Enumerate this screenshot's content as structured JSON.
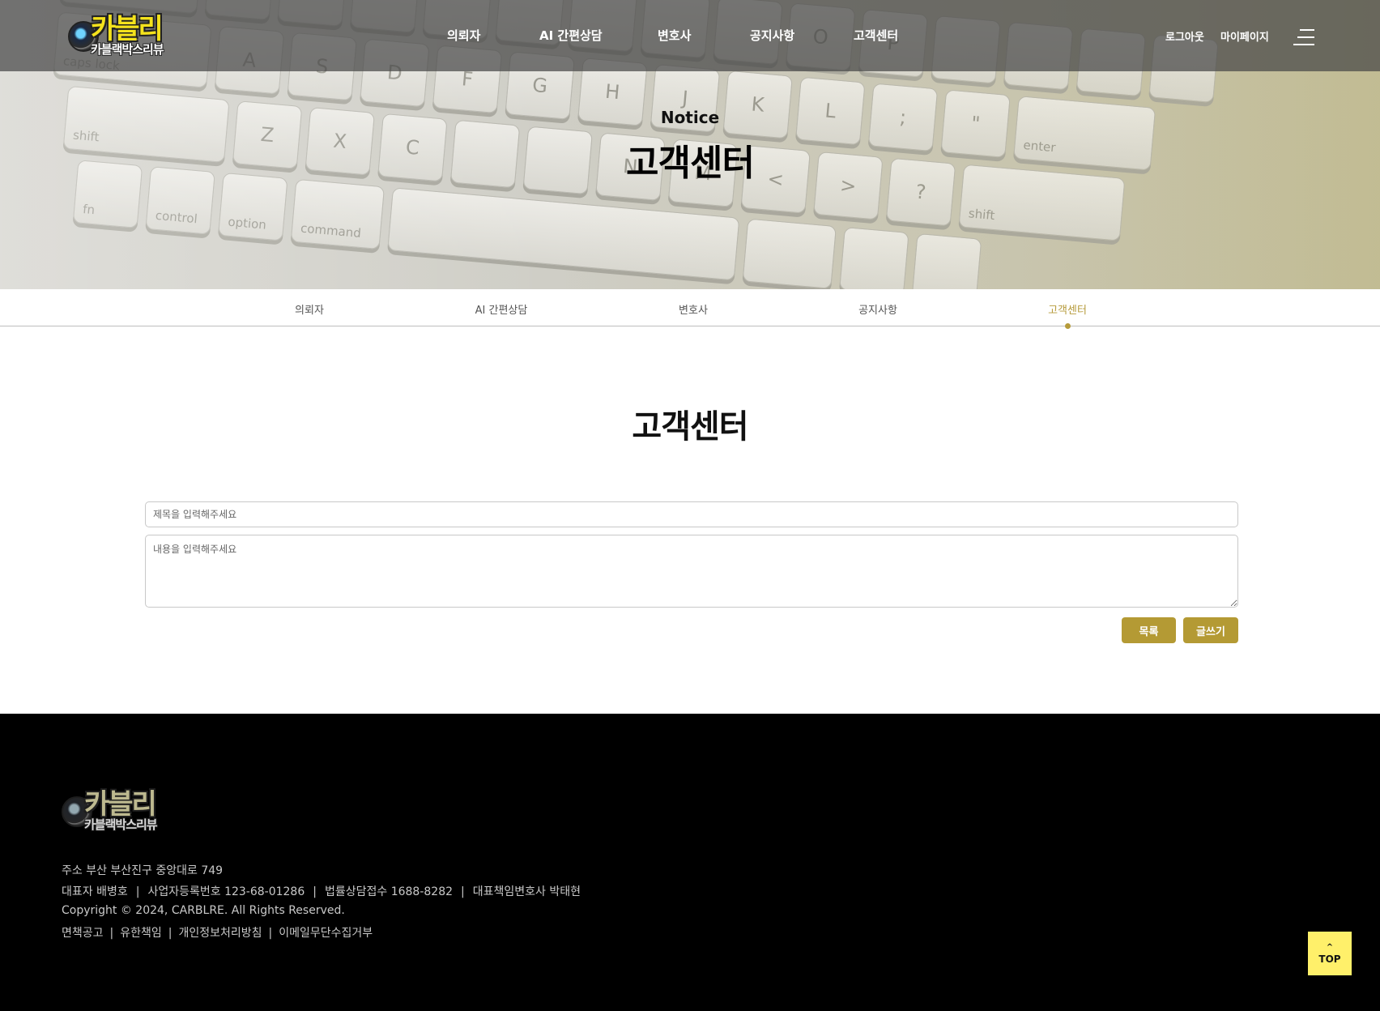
{
  "header": {
    "logo": {
      "main": "카블리",
      "sub": "카블랙박스리뷰"
    },
    "nav": [
      "의뢰자",
      "AI 간편상담",
      "변호사",
      "공지사항",
      "고객센터"
    ],
    "util": {
      "logout": "로그아웃",
      "mypage": "마이페이지"
    },
    "menu_icon": "hamburger-icon"
  },
  "hero": {
    "en_title": "Notice",
    "ko_title": "고객센터"
  },
  "subnav": {
    "items": [
      "의뢰자",
      "AI 간편상담",
      "변호사",
      "공지사항",
      "고객센터"
    ],
    "active": "고객센터",
    "accent_color": "#b69b3b"
  },
  "content": {
    "page_title": "고객센터",
    "title_placeholder": "제목을 입력해주세요",
    "body_placeholder": "내용을 입력해주세요",
    "list_button": "목록",
    "write_button": "글쓰기",
    "button_color": "#b49a34"
  },
  "footer": {
    "logo": {
      "main": "카블리",
      "sub": "카블랙박스리뷰"
    },
    "address": "주소 부산 부산진구 중앙대로 749",
    "ceo": "대표자 배병호",
    "biz_no": "사업자등록번호 123-68-01286",
    "legal_phone": "법률상담접수 1688-8282",
    "lawyer": "대표책임변호사 박태현",
    "copyright": "Copyright © 2024, CARBLRE. All Rights Reserved.",
    "links": [
      "면책공고",
      "유한책임",
      "개인정보처리방침",
      "이메일무단수집거부"
    ]
  },
  "top_button": {
    "arrow": "^",
    "label": "TOP",
    "color": "#fff06a"
  }
}
